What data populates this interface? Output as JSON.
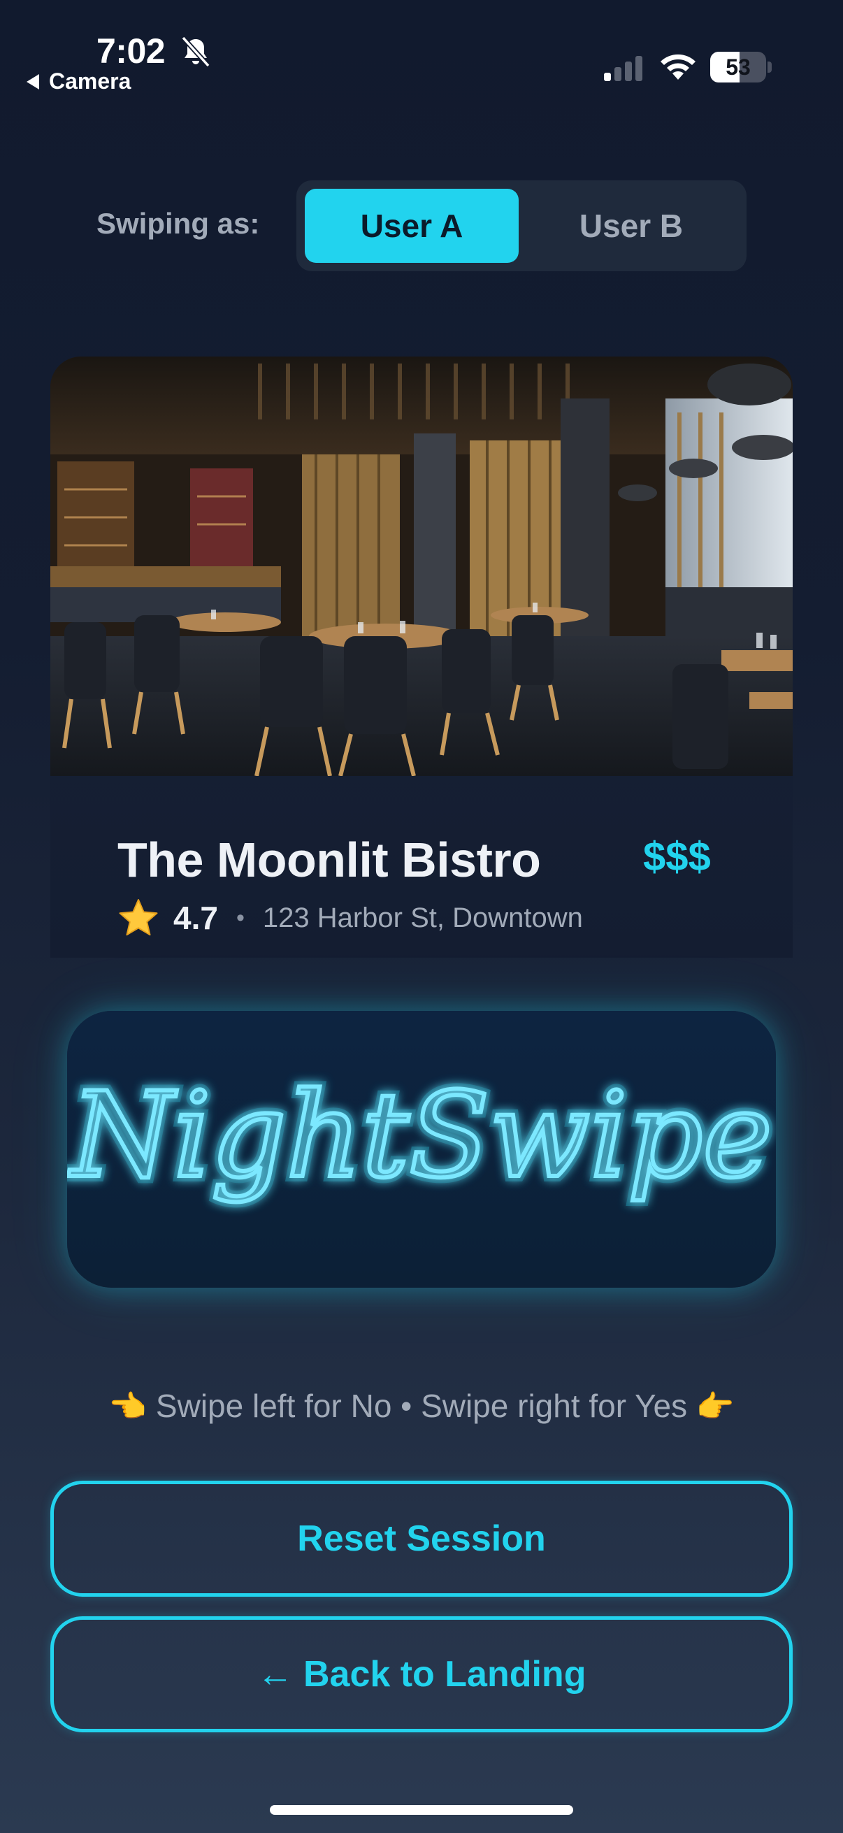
{
  "status_bar": {
    "time": "7:02",
    "back_app": "Camera",
    "battery_percent": "53",
    "battery_level": 0.53,
    "icons": [
      "bell-slash-icon",
      "signal-icon",
      "wifi-icon",
      "battery-icon"
    ]
  },
  "switcher": {
    "label": "Swiping as:",
    "options": [
      "User A",
      "User B"
    ],
    "selected": "User A"
  },
  "restaurant": {
    "name": "The Moonlit Bistro",
    "price": "$$$",
    "rating": "4.7",
    "separator": "•",
    "address": "123 Harbor St, Downtown"
  },
  "logo": {
    "text": "NightSwipe"
  },
  "hint": {
    "left_emoji": "👈",
    "text": "Swipe left for No • Swipe right for Yes",
    "right_emoji": "👉"
  },
  "buttons": {
    "reset": "Reset Session",
    "back": "← Back to Landing"
  },
  "colors": {
    "accent": "#22d3ee",
    "background_top": "#111a2e",
    "background_bottom": "#2b3a51",
    "muted_text": "#a2abb9"
  }
}
